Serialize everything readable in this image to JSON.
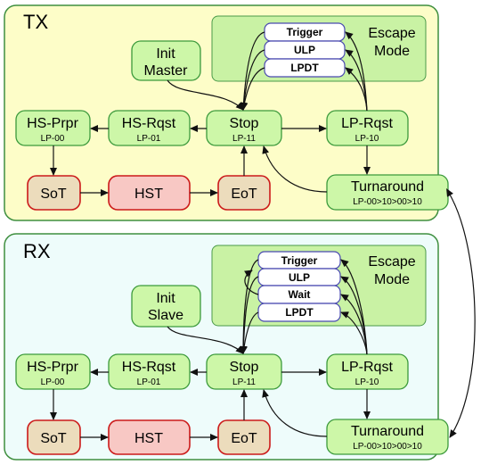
{
  "tx": {
    "title": "TX",
    "escape": {
      "line1": "Escape",
      "line2": "Mode",
      "items": [
        "Trigger",
        "ULP",
        "LPDT"
      ]
    },
    "init": {
      "line1": "Init",
      "line2": "Master"
    },
    "hs_prpr": {
      "label": "HS-Prpr",
      "sub": "LP-00"
    },
    "hs_rqst": {
      "label": "HS-Rqst",
      "sub": "LP-01"
    },
    "stop": {
      "label": "Stop",
      "sub": "LP-11"
    },
    "lp_rqst": {
      "label": "LP-Rqst",
      "sub": "LP-10"
    },
    "sot": "SoT",
    "hst": "HST",
    "eot": "EoT",
    "turnaround": {
      "label": "Turnaround",
      "sub": "LP-00>10>00>10"
    }
  },
  "rx": {
    "title": "RX",
    "escape": {
      "line1": "Escape",
      "line2": "Mode",
      "items": [
        "Trigger",
        "ULP",
        "Wait",
        "LPDT"
      ]
    },
    "init": {
      "line1": "Init",
      "line2": "Slave"
    },
    "hs_prpr": {
      "label": "HS-Prpr",
      "sub": "LP-00"
    },
    "hs_rqst": {
      "label": "HS-Rqst",
      "sub": "LP-01"
    },
    "stop": {
      "label": "Stop",
      "sub": "LP-11"
    },
    "lp_rqst": {
      "label": "LP-Rqst",
      "sub": "LP-10"
    },
    "sot": "SoT",
    "hst": "HST",
    "eot": "EoT",
    "turnaround": {
      "label": "Turnaround",
      "sub": "LP-00>10>00>10"
    }
  },
  "colors": {
    "state": "#cdf7a8",
    "hs_state": "#f8c8c4",
    "tx_panel": "#fdfdc8",
    "rx_panel": "#eefcfb"
  }
}
